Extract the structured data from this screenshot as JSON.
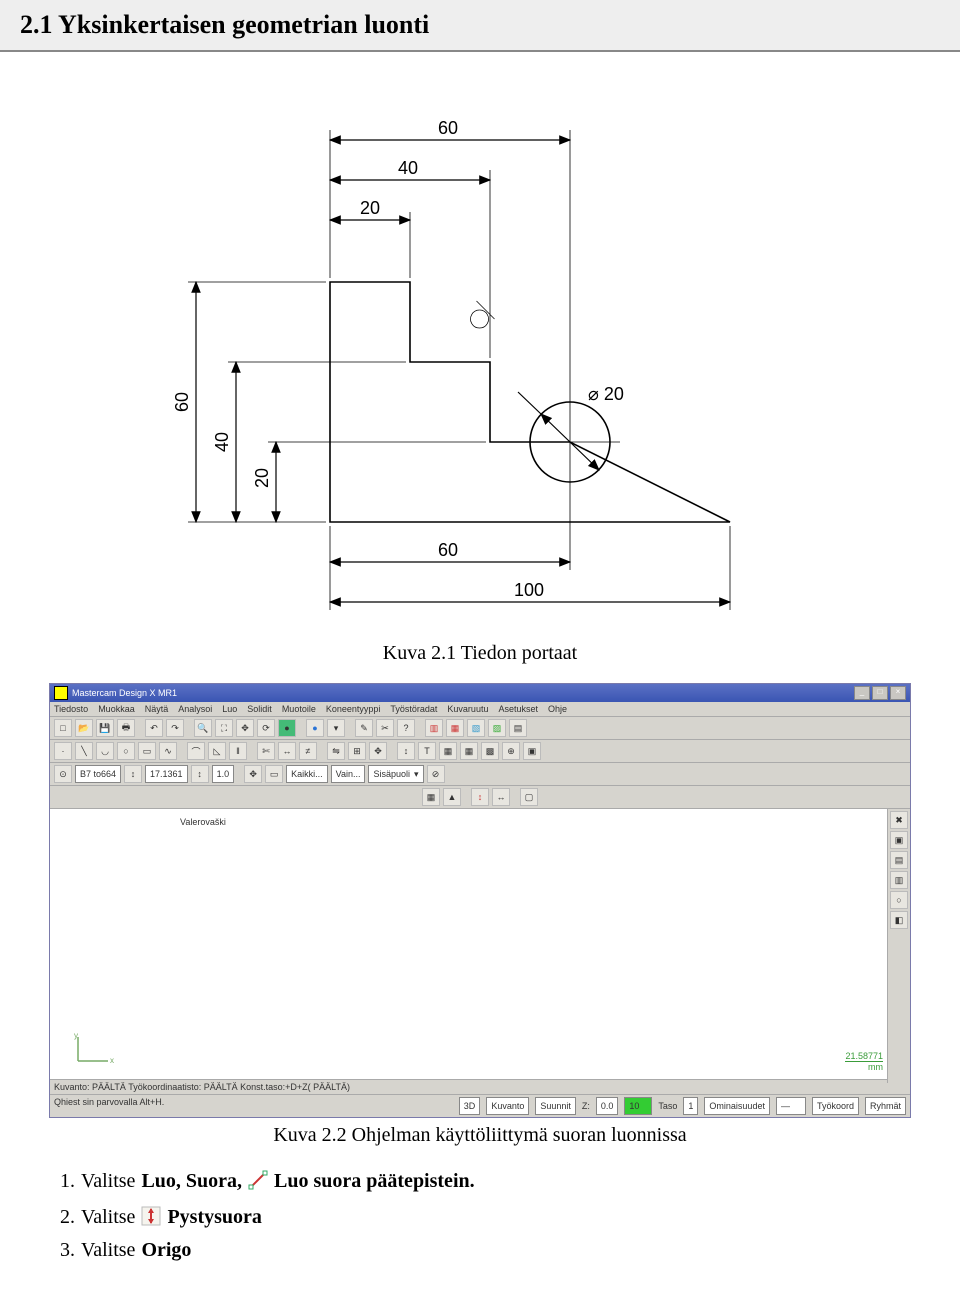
{
  "section_heading": "2.1 Yksinkertaisen geometrian luonti",
  "drawing": {
    "dim_top_outer": "60",
    "dim_top_mid": "40",
    "dim_top_inner": "20",
    "dim_left_outer": "60",
    "dim_left_mid": "40",
    "dim_left_inner": "20",
    "dim_bottom_inner": "60",
    "dim_bottom_outer": "100",
    "circle_diam": "20"
  },
  "caption1": "Kuva 2.1 Tiedon portaat",
  "screenshot": {
    "title": "Mastercam Design X MR1",
    "menus": [
      "Tiedosto",
      "Muokkaa",
      "Näytä",
      "Analysoi",
      "Luo",
      "Solidit",
      "Muotoile",
      "Koneentyyppi",
      "Työstöradat",
      "Kuvaruutu",
      "Asetukset",
      "Ohje"
    ],
    "combo1": "B7 to664",
    "combo2": "17.1361",
    "combo_z": "1.0",
    "combo_kaikki": "Kaikki...",
    "combo_vain": "Vain...",
    "combo_sisa": "Sisäpuoli",
    "valikko": "Valerovaški",
    "coord_value": "21.58771",
    "coord_unit": "mm",
    "status_left": "Kuvanto: PÄÄLTÄ  Työkoordinaatisto: PÄÄLTÄ  Konst.taso:+D+Z( PÄÄLTÄ)",
    "status_hint": "Qhiest sin parvovalla Alt+H.",
    "status_3d": "3D",
    "status_kuvanto": "Kuvanto",
    "status_suunnit": "Suunnit",
    "status_z": "Z:",
    "status_zval": "0.0",
    "status_taso": "Taso",
    "status_tasoval": "1",
    "status_omin": "Ominaisuudet",
    "status_tyokoord": "Työkoord",
    "status_ryhmat": "Ryhmät"
  },
  "caption2": "Kuva 2.2 Ohjelman käyttöliittymä suoran luonnissa",
  "instructions": {
    "step1_num": "1.",
    "step1_a": "Valitse",
    "step1_b": "Luo, Suora,",
    "step1_c": "Luo suora päätepistein.",
    "step2_num": "2.",
    "step2_a": "Valitse",
    "step2_b": "Pystysuora",
    "step3_num": "3.",
    "step3_a": "Valitse",
    "step3_b": "Origo"
  }
}
